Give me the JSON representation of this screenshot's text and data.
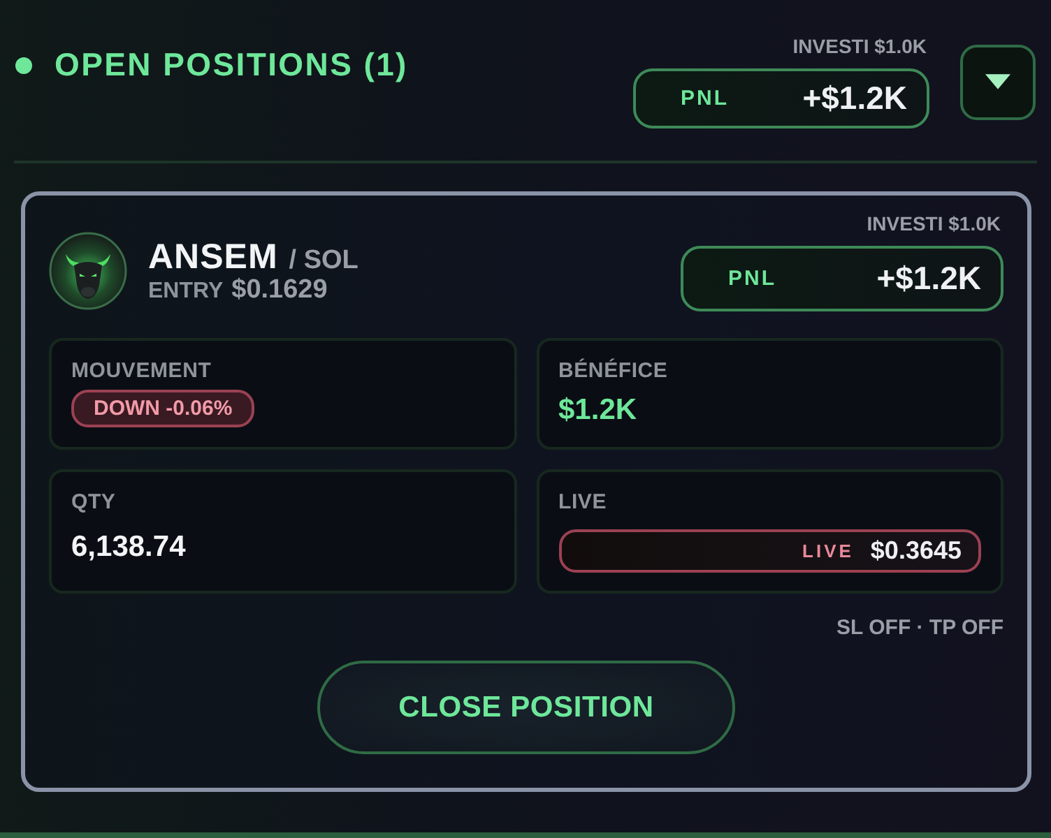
{
  "header": {
    "title": "OPEN POSITIONS (1)",
    "invested": "INVESTI $1.0K",
    "pnl_label": "PNL",
    "pnl_value": "+$1.2K"
  },
  "position": {
    "symbol": "ANSEM",
    "pair": "/ SOL",
    "entry_label": "ENTRY",
    "entry_value": "$0.1629",
    "invested": "INVESTI $1.0K",
    "pnl_label": "PNL",
    "pnl_value": "+$1.2K",
    "stats": [
      {
        "kind": "badge",
        "label": "MOUVEMENT",
        "value": "DOWN -0.06%",
        "negative": true
      },
      {
        "kind": "value",
        "label": "BÉNÉFICE",
        "value": "$1.2K",
        "highlight": true
      },
      {
        "kind": "value",
        "label": "QTY",
        "value": "6,138.74",
        "highlight": false
      },
      {
        "kind": "live",
        "label": "LIVE",
        "tag": "LIVE",
        "value": "$0.3645"
      }
    ],
    "risk": "SL OFF · TP OFF",
    "close_button": "CLOSE POSITION"
  }
}
